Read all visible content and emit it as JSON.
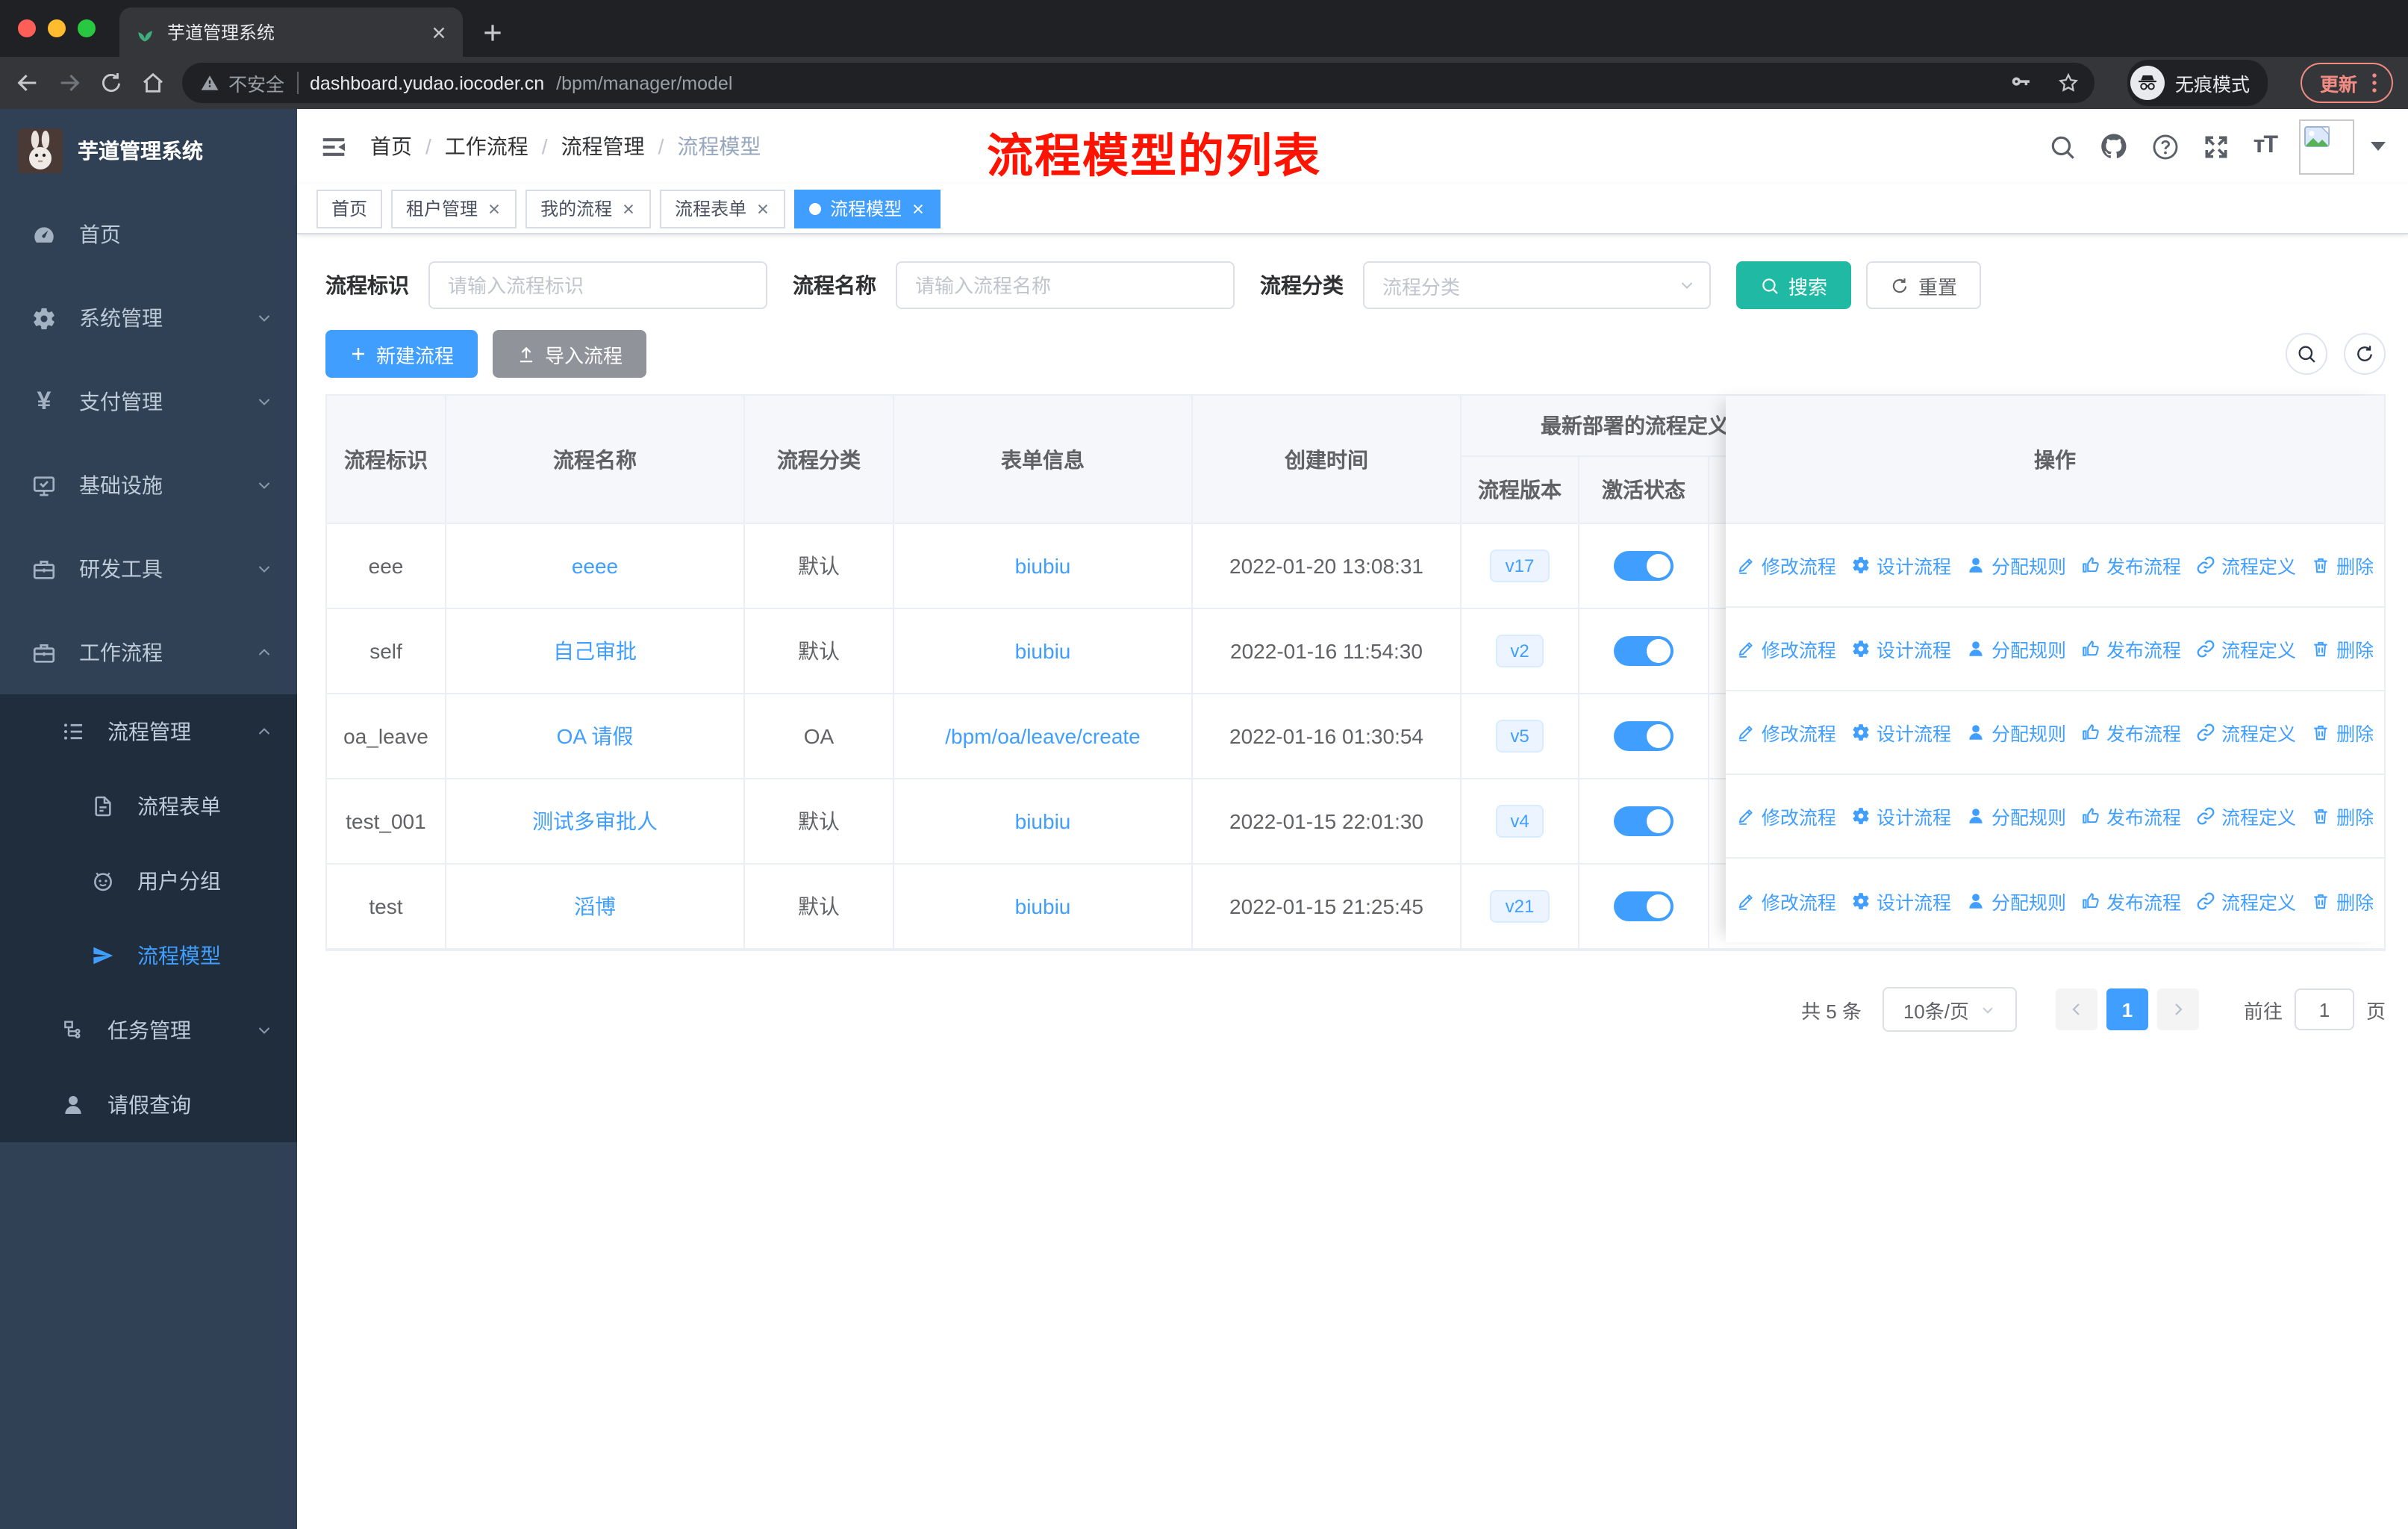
{
  "colors": {
    "primary": "#409eff",
    "search_teal": "#20baa4",
    "sidebar_bg": "#304156",
    "submenu_bg": "#1f2d3d",
    "annotation_red": "#fe1300",
    "update_coral": "#f28b82"
  },
  "browser": {
    "tab_title": "芋道管理系统",
    "security": "不安全",
    "host": "dashboard.yudao.iocoder.cn",
    "path": "/bpm/manager/model",
    "incognito": "无痕模式",
    "update": "更新"
  },
  "sidebar": {
    "title": "芋道管理系统",
    "items": {
      "home": "首页",
      "system": "系统管理",
      "pay": "支付管理",
      "infra": "基础设施",
      "dev": "研发工具",
      "workflow": "工作流程",
      "process_mgmt": "流程管理",
      "process_form": "流程表单",
      "user_group": "用户分组",
      "process_model": "流程模型",
      "task_mgmt": "任务管理",
      "leave_query": "请假查询"
    }
  },
  "navbar": {
    "breadcrumb": [
      "首页",
      "工作流程",
      "流程管理",
      "流程模型"
    ],
    "separator": "/",
    "annotation": "流程模型的列表"
  },
  "tags": {
    "t0": "首页",
    "t1": "租户管理",
    "t2": "我的流程",
    "t3": "流程表单",
    "t4": "流程模型"
  },
  "filter": {
    "id_label": "流程标识",
    "id_placeholder": "请输入流程标识",
    "name_label": "流程名称",
    "name_placeholder": "请输入流程名称",
    "category_label": "流程分类",
    "category_placeholder": "流程分类",
    "search": "搜索",
    "reset": "重置"
  },
  "toolbar": {
    "create": "新建流程",
    "import": "导入流程"
  },
  "table": {
    "h_id": "流程标识",
    "h_name": "流程名称",
    "h_category": "流程分类",
    "h_form": "表单信息",
    "h_created": "创建时间",
    "h_group": "最新部署的流程定义",
    "h_version": "流程版本",
    "h_status": "激活状态",
    "h_actions": "操作",
    "actions": [
      "修改流程",
      "设计流程",
      "分配规则",
      "发布流程",
      "流程定义",
      "删除"
    ],
    "rows": [
      {
        "id": "eee",
        "name": "eeee",
        "category": "默认",
        "form": "biubiu",
        "created": "2022-01-20 13:08:31",
        "version": "v17",
        "active": true
      },
      {
        "id": "self",
        "name": "自己审批",
        "category": "默认",
        "form": "biubiu",
        "created": "2022-01-16 11:54:30",
        "version": "v2",
        "active": true
      },
      {
        "id": "oa_leave",
        "name": "OA 请假",
        "category": "OA",
        "form": "/bpm/oa/leave/create",
        "created": "2022-01-16 01:30:54",
        "version": "v5",
        "active": true
      },
      {
        "id": "test_001",
        "name": "测试多审批人",
        "category": "默认",
        "form": "biubiu",
        "created": "2022-01-15 22:01:30",
        "version": "v4",
        "active": true
      },
      {
        "id": "test",
        "name": "滔博",
        "category": "默认",
        "form": "biubiu",
        "created": "2022-01-15 21:25:45",
        "version": "v21",
        "active": true
      }
    ]
  },
  "pagination": {
    "total": "共 5 条",
    "page_size": "10条/页",
    "page": "1",
    "goto_label": "前往",
    "goto_value": "1",
    "unit": "页"
  }
}
